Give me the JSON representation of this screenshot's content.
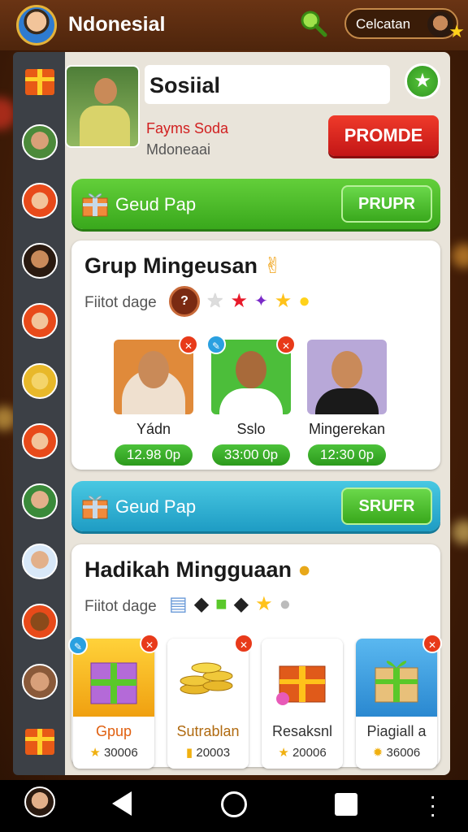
{
  "app": {
    "title": "Ndonesial",
    "user_chip": "Celcatan"
  },
  "profile": {
    "title": "Sosiial",
    "name": "Fayms Soda",
    "subtitle": "Mdoneaai",
    "promo_label": "PROMDE"
  },
  "green_bar": {
    "label": "Geud Pap",
    "button": "PRUPR"
  },
  "group_section": {
    "title": "Grup Mingeusan",
    "subtitle": "Fiitot dage",
    "members": [
      {
        "name": "Yádn",
        "value": "12.98 0p"
      },
      {
        "name": "Sslo",
        "value": "33:00 0p"
      },
      {
        "name": "Mingerekan",
        "value": "12:30 0p"
      }
    ]
  },
  "blue_bar": {
    "label": "Geud Pap",
    "button": "SRUFR"
  },
  "prize_section": {
    "title": "Hadikah Mingguaan",
    "subtitle": "Fiitot dage",
    "items": [
      {
        "name": "Gpup",
        "price": "30006",
        "name_color": "#e06010"
      },
      {
        "name": "Sutrablan",
        "price": "20003",
        "name_color": "#b06a10"
      },
      {
        "name": "Resaksnl",
        "price": "20006",
        "name_color": "#333333"
      },
      {
        "name": "Piagiall a",
        "price": "36006",
        "name_color": "#333333"
      }
    ]
  },
  "colors": {
    "green": "#3aaa1e",
    "blue": "#1e9cc4",
    "red": "#c31616",
    "top_bar": "#5a2b0e"
  }
}
